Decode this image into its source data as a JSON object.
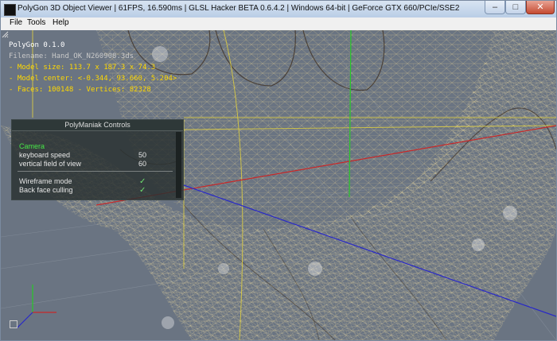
{
  "window": {
    "title": "PolyGon 3D Object Viewer | 61FPS, 16.590ms | GLSL Hacker BETA 0.6.4.2 | Windows 64-bit | GeForce GTX 660/PCIe/SSE2",
    "minimize_glyph": "–",
    "maximize_glyph": "□",
    "close_glyph": "✕"
  },
  "menu": {
    "file": "File",
    "tools": "Tools",
    "help": "Help"
  },
  "hud": {
    "title": "PolyGon 0.1.0",
    "filename": "Filename: Hand_OK_N260908.3ds",
    "model_size": "- Model size: 113.7 x 187.3 x 74.3",
    "model_center": "- Model center: <-0.344, 93.660, 5.204>",
    "faces_vertices": "- Faces: 100148 - Vertices: 82328"
  },
  "controls": {
    "title": "PolyManiak Controls",
    "camera_label": "Camera",
    "keyboard_speed_label": "keyboard speed",
    "keyboard_speed_value": "50",
    "fov_label": "vertical field of view",
    "fov_value": "60",
    "wireframe_label": "Wireframe mode",
    "wireframe_check": "✓",
    "backface_label": "Back face culling",
    "backface_check": "✓"
  },
  "colors": {
    "mesh_wire": "#d8c890",
    "hud_accent": "#ffd800",
    "section_green": "#48e848",
    "axis_red": "#c82828",
    "axis_blue": "#2828c8",
    "axis_green": "#28c828"
  }
}
